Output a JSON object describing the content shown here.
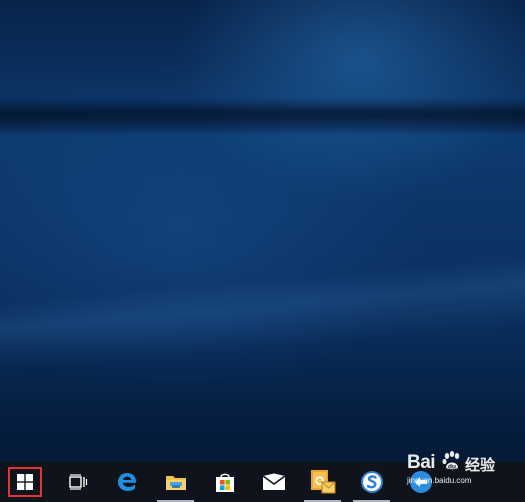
{
  "desktop": {
    "wallpaper": "Windows 10 hero blue"
  },
  "taskbar": {
    "background": "#0f141c",
    "start_highlight_color": "#e03434",
    "items": [
      {
        "name": "start",
        "icon": "windows-logo-icon",
        "running": false
      },
      {
        "name": "task-view",
        "icon": "task-view-icon",
        "running": false
      },
      {
        "name": "edge",
        "icon": "edge-icon",
        "running": false
      },
      {
        "name": "file-explorer",
        "icon": "folder-icon",
        "running": true
      },
      {
        "name": "store",
        "icon": "store-bag-icon",
        "running": false
      },
      {
        "name": "mail",
        "icon": "mail-envelope-icon",
        "running": false
      },
      {
        "name": "outlook",
        "icon": "outlook-icon",
        "running": true
      },
      {
        "name": "sogou",
        "icon": "sogou-s-icon",
        "running": true
      },
      {
        "name": "app",
        "icon": "blue-circle-app-icon",
        "running": false
      }
    ]
  },
  "watermark": {
    "logo": "Bai",
    "chinese": "经验",
    "url": "jingyan.baidu.com"
  }
}
